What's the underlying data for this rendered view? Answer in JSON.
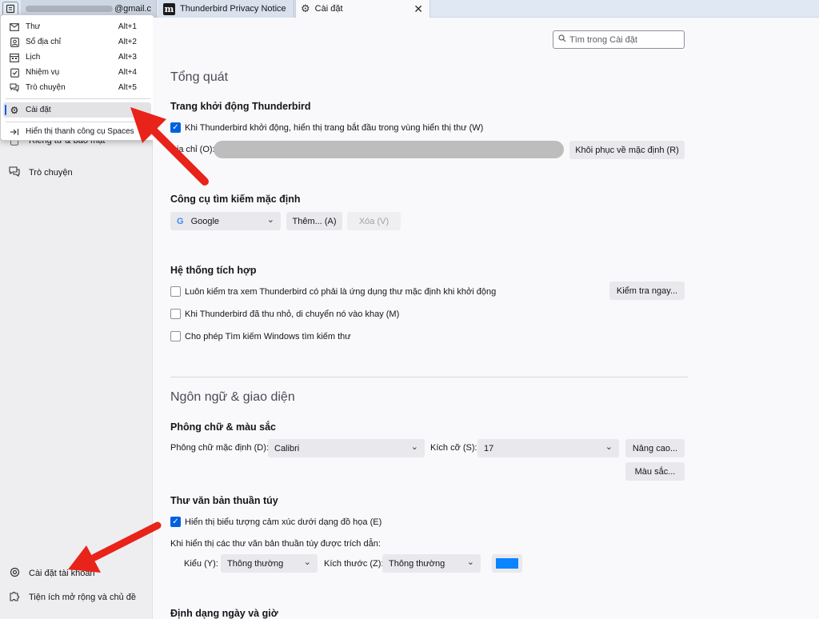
{
  "tabs": [
    {
      "label": "@gmail.c"
    },
    {
      "label": "Thunderbird Privacy Notice"
    },
    {
      "label": "Cài đặt"
    }
  ],
  "menu": {
    "items": [
      {
        "label": "Thư",
        "shortcut": "Alt+1",
        "icon": "mail-icon"
      },
      {
        "label": "Sổ địa chỉ",
        "shortcut": "Alt+2",
        "icon": "address-book-icon"
      },
      {
        "label": "Lịch",
        "shortcut": "Alt+3",
        "icon": "calendar-icon"
      },
      {
        "label": "Nhiệm vụ",
        "shortcut": "Alt+4",
        "icon": "tasks-icon"
      },
      {
        "label": "Trò chuyện",
        "shortcut": "Alt+5",
        "icon": "chat-icon"
      },
      {
        "label": "Cài đặt",
        "shortcut": "",
        "icon": "gear-icon"
      },
      {
        "label": "Hiển thị thanh công cụ Spaces",
        "shortcut": "",
        "icon": "show-toolbar-icon"
      }
    ]
  },
  "sidebar": {
    "partial_item": "Riêng tư & bảo mật",
    "chat": "Trò chuyện",
    "account_settings": "Cài đặt tài khoản",
    "addons": "Tiện ích mở rộng và chủ đề"
  },
  "search": {
    "placeholder": "Tìm trong Cài đặt"
  },
  "general": {
    "title": "Tổng quát",
    "startup": {
      "heading": "Trang khởi động Thunderbird",
      "checkbox": "Khi Thunderbird khởi động, hiển thị trang bắt đầu trong vùng hiển thị thư (W)",
      "checked": true,
      "address_label": "Địa chỉ (O):",
      "restore_button": "Khôi phục về mặc định (R)"
    },
    "search_engine": {
      "heading": "Công cụ tìm kiếm mặc định",
      "selected": "Google",
      "add_button": "Thêm... (A)",
      "remove_button": "Xóa (V)"
    },
    "integration": {
      "heading": "Hệ thống tích hợp",
      "items": [
        {
          "label": "Luôn kiểm tra xem Thunderbird có phải là ứng dụng thư mặc định khi khởi động",
          "checked": false
        },
        {
          "label": "Khi Thunderbird đã thu nhỏ, di chuyển nó vào khay (M)",
          "checked": false
        },
        {
          "label": "Cho phép Tìm kiếm Windows tìm kiếm thư",
          "checked": false
        }
      ],
      "check_now_button": "Kiểm tra ngay..."
    }
  },
  "language": {
    "title": "Ngôn ngữ & giao diện",
    "fonts": {
      "heading": "Phông chữ & màu sắc",
      "default_font_label": "Phông chữ mặc định (D):",
      "default_font": "Calibri",
      "size_label": "Kích cỡ (S):",
      "size": "17",
      "advanced_button": "Nâng cao...",
      "colors_button": "Màu sắc..."
    },
    "plaintext": {
      "heading": "Thư văn bản thuần túy",
      "emoticons": "Hiển thị biểu tượng cảm xúc dưới dạng đồ họa (E)",
      "emoticons_checked": true,
      "quoted_label": "Khi hiển thị các thư văn bản thuần túy được trích dẫn:",
      "style_label": "Kiểu (Y):",
      "style_value": "Thông thường",
      "size_label": "Kích thước (Z):",
      "size_value": "Thông thường",
      "color": "#0a84ff"
    },
    "date_heading": "Định dạng ngày và giờ"
  },
  "annotation_color": "#e8231a"
}
